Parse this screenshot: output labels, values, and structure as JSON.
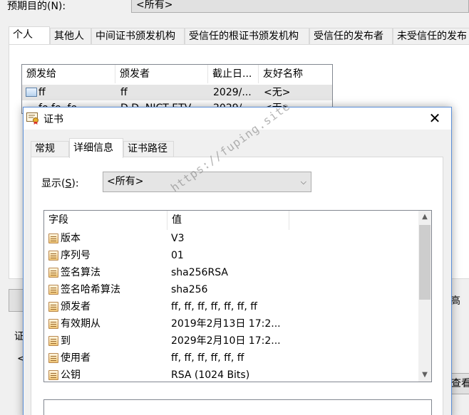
{
  "background_window": {
    "purpose_label": "预期目的(N):",
    "purpose_value": "<所有>",
    "tabs": [
      "个人",
      "其他人",
      "中间证书颁发机构",
      "受信任的根证书颁发机构",
      "受信任的发布者",
      "未受信任的发布"
    ],
    "list": {
      "columns": [
        "颁发给",
        "颁发者",
        "截止日...",
        "友好名称"
      ],
      "rows": [
        {
          "issued_to": "ff",
          "issuer": "ff",
          "expires": "2029/...",
          "friendly_name": "<无>"
        },
        {
          "issued_to": "fe.fe..fe",
          "issuer": "D.D. NICT ETV...",
          "expires": "2029/...",
          "friendly_name": "<无>"
        }
      ]
    },
    "group_label": "证",
    "lt_glyph": "<",
    "right_button_partial": "高",
    "view_button_partial": "查看"
  },
  "dialog": {
    "title": "证书",
    "close_glyph": "✕",
    "tabs": [
      "常规",
      "详细信息",
      "证书路径"
    ],
    "show_label_prefix": "显示(",
    "show_label_key": "S",
    "show_label_suffix": "):",
    "show_value": "<所有>",
    "dropdown_glyph": "⌵",
    "fields_table": {
      "columns": [
        "字段",
        "值"
      ],
      "rows": [
        {
          "field": "版本",
          "value": "V3"
        },
        {
          "field": "序列号",
          "value": "01"
        },
        {
          "field": "签名算法",
          "value": "sha256RSA"
        },
        {
          "field": "签名哈希算法",
          "value": "sha256"
        },
        {
          "field": "颁发者",
          "value": "ff, ff, ff, ff, ff, ff, ff"
        },
        {
          "field": "有效期从",
          "value": "2019年2月13日 17:2..."
        },
        {
          "field": "到",
          "value": "2029年2月10日 17:2..."
        },
        {
          "field": "使用者",
          "value": "ff, ff, ff, ff, ff, ff"
        },
        {
          "field": "公钥",
          "value": "RSA (1024 Bits)"
        }
      ]
    },
    "scroll_up_glyph": "▲",
    "scroll_down_glyph": "▼"
  },
  "watermark": "https://fuping.site"
}
